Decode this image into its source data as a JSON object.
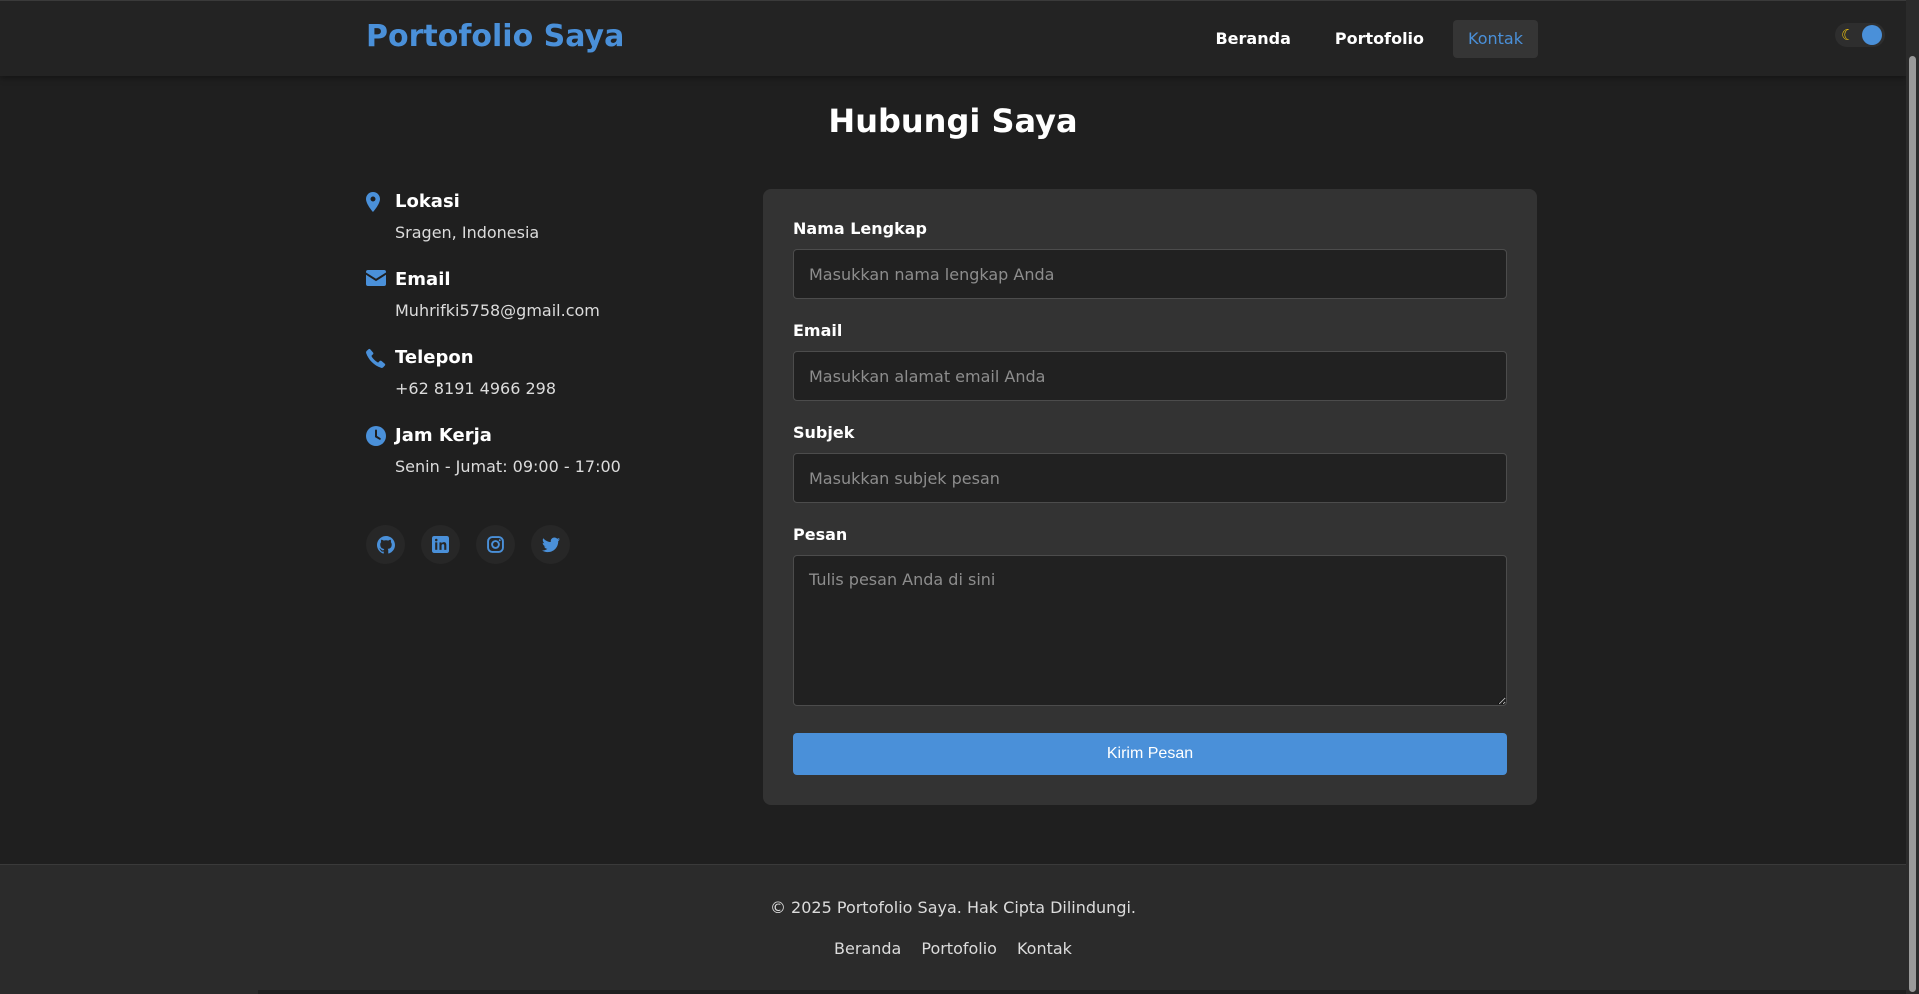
{
  "header": {
    "brand": "Portofolio Saya",
    "nav": [
      {
        "label": "Beranda"
      },
      {
        "label": "Portofolio"
      },
      {
        "label": "Kontak",
        "active": true
      }
    ],
    "theme_toggle": {
      "icon": "moon-icon",
      "mode": "dark"
    }
  },
  "main": {
    "title": "Hubungi Saya",
    "info": [
      {
        "icon": "map-pin-icon",
        "title": "Lokasi",
        "text": "Sragen, Indonesia"
      },
      {
        "icon": "envelope-icon",
        "title": "Email",
        "text": "Muhrifki5758@gmail.com"
      },
      {
        "icon": "phone-icon",
        "title": "Telepon",
        "text": "+62 8191 4966 298"
      },
      {
        "icon": "clock-icon",
        "title": "Jam Kerja",
        "text": "Senin - Jumat: 09:00 - 17:00"
      }
    ],
    "socials": [
      "github-icon",
      "linkedin-icon",
      "instagram-icon",
      "twitter-icon"
    ],
    "form": {
      "name": {
        "label": "Nama Lengkap",
        "placeholder": "Masukkan nama lengkap Anda",
        "value": ""
      },
      "email": {
        "label": "Email",
        "placeholder": "Masukkan alamat email Anda",
        "value": ""
      },
      "subject": {
        "label": "Subjek",
        "placeholder": "Masukkan subjek pesan",
        "value": ""
      },
      "message": {
        "label": "Pesan",
        "placeholder": "Tulis pesan Anda di sini",
        "value": ""
      },
      "submit_label": "Kirim Pesan"
    }
  },
  "footer": {
    "copyright": "© 2025 Portofolio Saya. Hak Cipta Dilindungi.",
    "links": [
      "Beranda",
      "Portofolio",
      "Kontak"
    ]
  },
  "colors": {
    "accent": "#4a90d9",
    "background": "#1f1f1f",
    "card": "#333333",
    "moon": "#f1c40f"
  }
}
